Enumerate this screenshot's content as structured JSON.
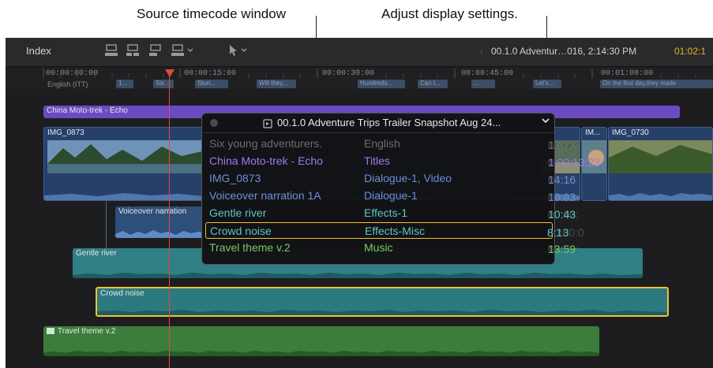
{
  "callouts": {
    "source_timecode_window": "Source timecode window",
    "adjust_display_settings": "Adjust display settings."
  },
  "toolbar": {
    "index_label": "Index",
    "project_title": "00.1.0 Adventur…016, 2:14:30 PM",
    "project_timecode": "01:02:1",
    "tool_icons": [
      "clip-connect-icon",
      "clip-insert-icon",
      "clip-append-icon",
      "clip-overwrite-icon",
      "arrow-select-tool-icon"
    ]
  },
  "ruler": {
    "ticks": [
      "00:00:00:00",
      "00:00:15:00",
      "00:00:30:00",
      "00:00:45:00",
      "00:01:00:00"
    ],
    "caption_lane_label": "English (ITT)",
    "captions": [
      "1...",
      "Six...",
      "Stun...",
      "Will they...",
      "Hundreds...",
      "Can t...",
      "...",
      "Let's...",
      "On the first day,they made"
    ]
  },
  "timeline": {
    "title_clip": "China Moto-trek - Echo",
    "video_clip_1": "IMG_0873",
    "video_clip_2": "IM...",
    "video_clip_3": "IMG_0730",
    "voiceover_clip": "Voiceover narration",
    "river_clip": "Gentle river",
    "crowd_clip": "Crowd noise",
    "music_clip": "Travel theme v.2"
  },
  "source_timecode_window": {
    "title": "00.1.0 Adventure Trips Trailer Snapshot Aug 24...",
    "rows": [
      {
        "name": "Six young adventurers.",
        "role": "English",
        "tc_dim": "00:00:",
        "tc": "13:23",
        "color": "#6e6e6e"
      },
      {
        "name": "China Moto-trek - Echo",
        "role": "Titles",
        "tc_dim": "0",
        "tc": "1:00:13:23",
        "color": "#9c7cf0"
      },
      {
        "name": "IMG_0873",
        "role": "Dialogue-1, Video",
        "tc_dim": "00:00:",
        "tc": "14:16",
        "color": "#6a8fd8"
      },
      {
        "name": "Voiceover narration 1A",
        "role": "Dialogue-1",
        "tc_dim": "00:00:",
        "tc": "10:03",
        "color": "#6a8fd8"
      },
      {
        "name": "Gentle river",
        "role": "Effects-1",
        "tc_dim": "00:00:",
        "tc": "10:43",
        "color": "#5cc6c9"
      },
      {
        "name": "Crowd noise",
        "role": "Effects-Misc",
        "tc_dim": "00:00:0",
        "tc": "8:13",
        "color": "#5cc6c9"
      },
      {
        "name": "Travel theme v.2",
        "role": "Music",
        "tc_dim": "00:00:",
        "tc": "13:59",
        "color": "#78c86a"
      }
    ]
  },
  "colors": {
    "playhead": "#e14a3c",
    "selection": "#f0c03a",
    "project_timecode": "#e6b422"
  }
}
